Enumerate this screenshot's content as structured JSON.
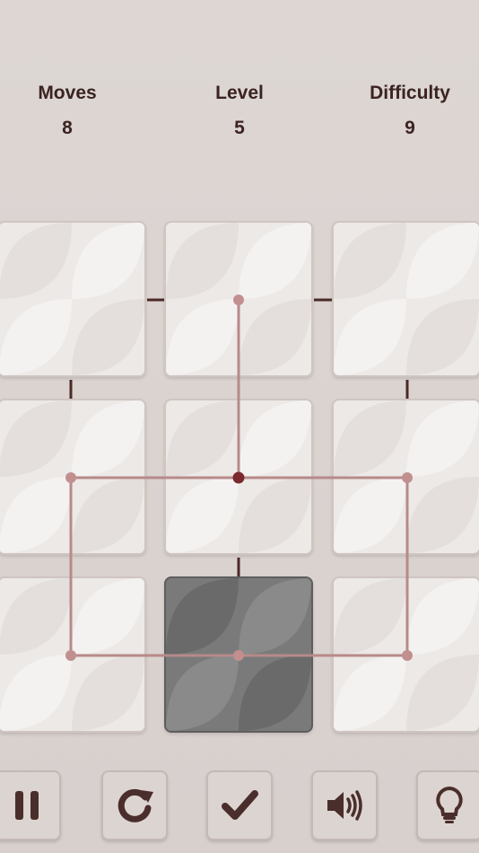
{
  "stats": {
    "moves": {
      "label": "Moves",
      "value": "8"
    },
    "level": {
      "label": "Level",
      "value": "5"
    },
    "difficulty": {
      "label": "Difficulty",
      "value": "9"
    }
  },
  "board": {
    "rows": 3,
    "cols": 3,
    "selected_tile": {
      "row": 2,
      "col": 1
    }
  },
  "toolbar": [
    {
      "name": "pause-button",
      "icon": "pause-icon"
    },
    {
      "name": "restart-button",
      "icon": "restart-icon"
    },
    {
      "name": "check-button",
      "icon": "checkmark-icon"
    },
    {
      "name": "sound-button",
      "icon": "speaker-icon"
    },
    {
      "name": "hint-button",
      "icon": "lightbulb-icon"
    }
  ],
  "colors": {
    "line": "#b78a8a",
    "connector": "#4a2a28",
    "node": "#c28f8f",
    "node_center": "#7a2a2e",
    "icon": "#4a2e2c"
  }
}
